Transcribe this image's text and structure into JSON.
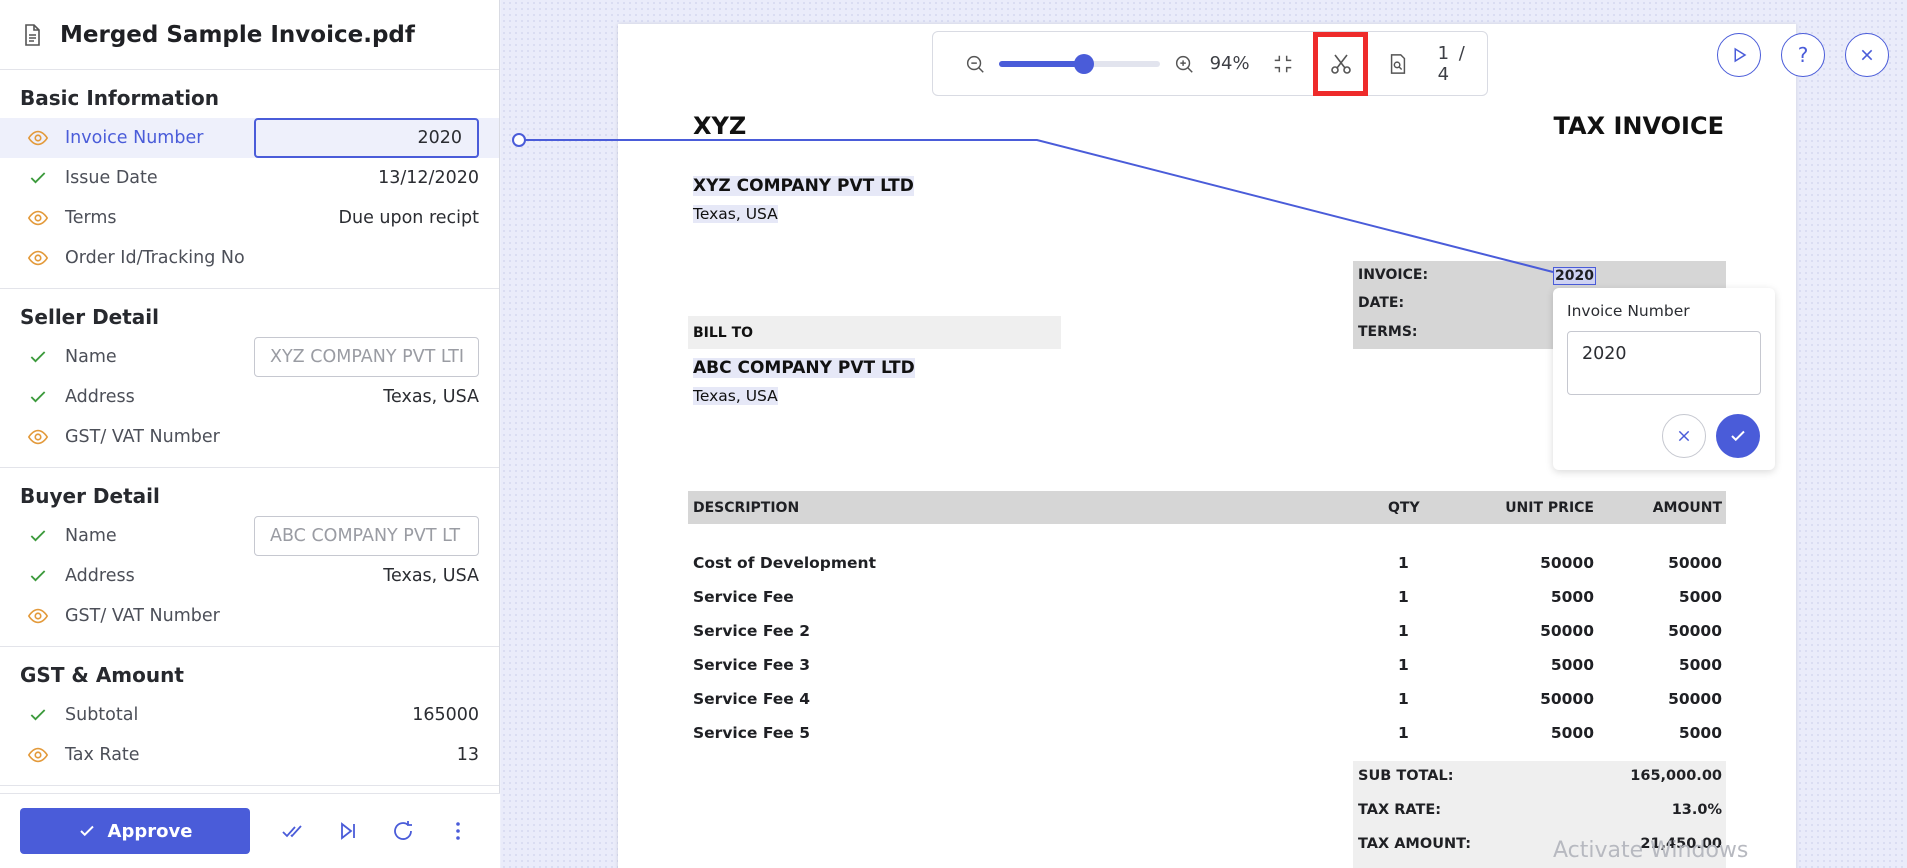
{
  "document": {
    "title": "Merged Sample Invoice.pdf",
    "icon": "file-icon"
  },
  "sections": [
    {
      "title": "Basic Information",
      "fields": [
        {
          "label": "Invoice Number",
          "status": "review",
          "input": "2020",
          "active": true
        },
        {
          "label": "Issue Date",
          "status": "ok",
          "value": "13/12/2020"
        },
        {
          "label": "Terms",
          "status": "review",
          "value": "Due upon recipt"
        },
        {
          "label": "Order Id/Tracking No",
          "status": "review",
          "value": ""
        }
      ]
    },
    {
      "title": "Seller Detail",
      "fields": [
        {
          "label": "Name",
          "status": "ok",
          "input": "XYZ COMPANY PVT LTI"
        },
        {
          "label": "Address",
          "status": "ok",
          "value": "Texas, USA"
        },
        {
          "label": "GST/ VAT Number",
          "status": "review",
          "value": ""
        }
      ]
    },
    {
      "title": "Buyer Detail",
      "fields": [
        {
          "label": "Name",
          "status": "ok",
          "input": "ABC COMPANY PVT LT"
        },
        {
          "label": "Address",
          "status": "ok",
          "value": "Texas, USA"
        },
        {
          "label": "GST/ VAT Number",
          "status": "review",
          "value": ""
        }
      ]
    },
    {
      "title": "GST & Amount",
      "fields": [
        {
          "label": "Subtotal",
          "status": "ok",
          "value": "165000"
        },
        {
          "label": "Tax Rate",
          "status": "review",
          "value": "13"
        }
      ]
    }
  ],
  "footer": {
    "approve_label": "Approve"
  },
  "toolbar": {
    "zoom": "94%",
    "zoom_level": 0.53,
    "page_current": "1",
    "page_total": "4",
    "page_label": "1 / 4"
  },
  "invoice": {
    "seller_short": "XYZ",
    "title": "TAX INVOICE",
    "seller_name": "XYZ COMPANY PVT LTD",
    "seller_location": "Texas, USA",
    "meta_labels": [
      "INVOICE:",
      "DATE:",
      "TERMS:"
    ],
    "invoice_value": "2020",
    "bill_to_label": "BILL TO",
    "buyer_name": "ABC COMPANY PVT LTD",
    "buyer_location": "Texas, USA",
    "columns": [
      "DESCRIPTION",
      "QTY",
      "UNIT PRICE",
      "AMOUNT"
    ],
    "rows": [
      [
        "Cost of Development",
        "1",
        "50000",
        "50000"
      ],
      [
        "Service Fee",
        "1",
        "5000",
        "5000"
      ],
      [
        "Service Fee 2",
        "1",
        "50000",
        "50000"
      ],
      [
        "Service Fee 3",
        "1",
        "5000",
        "5000"
      ],
      [
        "Service Fee 4",
        "1",
        "50000",
        "50000"
      ],
      [
        "Service Fee 5",
        "1",
        "5000",
        "5000"
      ]
    ],
    "totals": [
      [
        "SUB TOTAL:",
        "165,000.00"
      ],
      [
        "TAX RATE:",
        "13.0%"
      ],
      [
        "TAX AMOUNT:",
        "21,450.00"
      ]
    ]
  },
  "popover": {
    "title": "Invoice Number",
    "value": "2020"
  },
  "watermark": "Activate Windows",
  "colors": {
    "accent": "#4a5cd9",
    "ok": "#3c9a3c",
    "review": "#e39a3b",
    "highlight": "#ee2b2b"
  }
}
